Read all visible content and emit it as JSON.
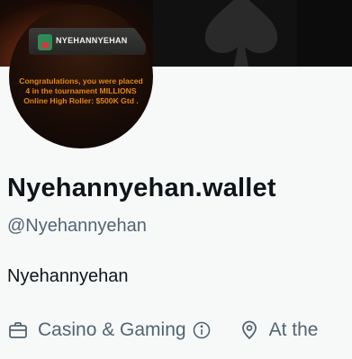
{
  "avatar": {
    "header_name": "NYEHANNYEHAN",
    "message": "Congratulations, you were placed 4 in the tournament MILLIONS Online High Roller: $500K Gtd ."
  },
  "profile": {
    "display_name": "Nyehannyehan.wallet",
    "handle": "@Nyehannyehan",
    "bio": "Nyehannyehan",
    "category": "Casino & Gaming",
    "location": "At the"
  },
  "icons": {
    "category": "briefcase-icon",
    "info": "info-icon",
    "location": "location-pin-icon"
  },
  "colors": {
    "text_primary": "#0f1419",
    "text_secondary": "#536471",
    "background": "#f7f9f9",
    "avatar_text": "#e0861a"
  }
}
